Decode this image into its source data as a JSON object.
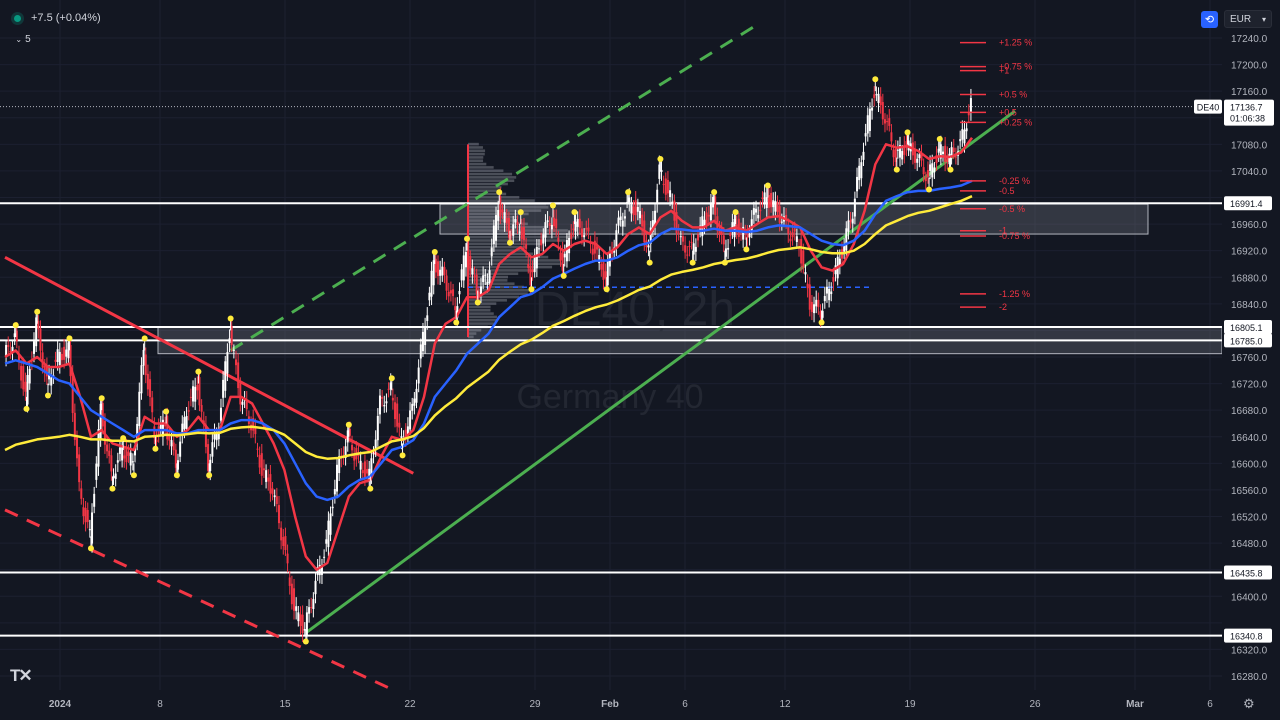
{
  "header": {
    "change": "+7.5 (+0.04%)",
    "interval": "5"
  },
  "currency": "EUR",
  "watermark": {
    "symbol": "DE40, 2h",
    "name": "Germany 40"
  },
  "chart_data": {
    "type": "candlestick",
    "symbol": "DE40",
    "timeframe": "2h",
    "y_axis": {
      "min": 16280,
      "max": 17240,
      "ticks": [
        17240.0,
        17200.0,
        17160.0,
        17120.0,
        17080.0,
        17040.0,
        17000.0,
        16960.0,
        16920.0,
        16880.0,
        16840.0,
        16800.0,
        16760.0,
        16720.0,
        16680.0,
        16640.0,
        16600.0,
        16560.0,
        16520.0,
        16480.0,
        16440.0,
        16400.0,
        16360.0,
        16320.0,
        16280.0
      ],
      "tick_labels": [
        "17240.0",
        "17200.0",
        "17160.0",
        "",
        "17080.0",
        "17040.0",
        "",
        "16960.0",
        "16920.0",
        "16880.0",
        "16840.0",
        "",
        "16760.0",
        "16720.0",
        "16680.0",
        "16640.0",
        "16600.0",
        "16560.0",
        "16520.0",
        "16480.0",
        "",
        "16400.0",
        "",
        "16320.0",
        "16280.0"
      ]
    },
    "x_axis": {
      "labels": [
        "2024",
        "8",
        "15",
        "22",
        "29",
        "Feb",
        "6",
        "12",
        "19",
        "26",
        "Mar",
        "6"
      ],
      "bold_labels": [
        "2024",
        "Feb",
        "Mar"
      ]
    },
    "price_labels": [
      {
        "text": "DE40",
        "value": 17136.7,
        "role": "symbol",
        "color": "#ffffff"
      },
      {
        "text": "17136.7",
        "value": 17136.7,
        "role": "last-price",
        "color": "#ffffff"
      },
      {
        "text": "01:06:38",
        "value": 17136.7,
        "role": "countdown",
        "color": "#ffffff"
      },
      {
        "text": "16991.4",
        "value": 16991.4,
        "role": "level",
        "color": "#ffffff"
      },
      {
        "text": "16805.1",
        "value": 16805.1,
        "role": "level",
        "color": "#ffffff"
      },
      {
        "text": "16785.0",
        "value": 16785.0,
        "role": "level",
        "color": "#ffffff"
      },
      {
        "text": "16435.8",
        "value": 16435.8,
        "role": "level",
        "color": "#ffffff"
      },
      {
        "text": "16340.8",
        "value": 16340.8,
        "role": "level",
        "color": "#ffffff"
      }
    ],
    "horizontal_levels": [
      16991.4,
      16805.1,
      16785.0,
      16435.8,
      16340.8
    ],
    "zones": [
      {
        "from": 16945,
        "to": 16990
      },
      {
        "from": 16765,
        "to": 16805
      }
    ],
    "pivot_labels": [
      {
        "text": "+1.25 %",
        "value": 17233
      },
      {
        "text": "+0.75 %",
        "value": 17197
      },
      {
        "text": "+1",
        "value": 17191
      },
      {
        "text": "+0.5 %",
        "value": 17155
      },
      {
        "text": "+0.5",
        "value": 17128
      },
      {
        "text": "+0.25 %",
        "value": 17113
      },
      {
        "text": "-0.25 %",
        "value": 17025
      },
      {
        "text": "-0.5",
        "value": 17010
      },
      {
        "text": "-0.5 %",
        "value": 16983
      },
      {
        "text": "-1",
        "value": 16950
      },
      {
        "text": "-0.75 %",
        "value": 16942
      },
      {
        "text": "-1.25 %",
        "value": 16855
      },
      {
        "text": "-2",
        "value": 16835
      }
    ],
    "price_path": [
      16760,
      16790,
      16700,
      16810,
      16720,
      16760,
      16770,
      16560,
      16490,
      16680,
      16580,
      16620,
      16600,
      16770,
      16640,
      16660,
      16600,
      16680,
      16720,
      16600,
      16660,
      16800,
      16700,
      16660,
      16590,
      16560,
      16480,
      16380,
      16350,
      16420,
      16480,
      16590,
      16640,
      16600,
      16580,
      16690,
      16710,
      16630,
      16680,
      16790,
      16900,
      16880,
      16830,
      16920,
      16860,
      16880,
      16990,
      16950,
      16960,
      16880,
      16940,
      16970,
      16900,
      16960,
      16950,
      16920,
      16880,
      16950,
      16990,
      16980,
      16920,
      17040,
      17000,
      16930,
      16920,
      16960,
      16990,
      16920,
      16960,
      16940,
      16980,
      17000,
      16980,
      16950,
      16930,
      16840,
      16830,
      16870,
      16920,
      16980,
      17080,
      17160,
      17120,
      17060,
      17080,
      17060,
      17030,
      17070,
      17060,
      17080,
      17140
    ],
    "series": [
      {
        "name": "EMA fast",
        "color": "#f23645",
        "values": [
          16760,
          16770,
          16750,
          16760,
          16745,
          16745,
          16750,
          16700,
          16640,
          16650,
          16630,
          16625,
          16620,
          16670,
          16660,
          16660,
          16640,
          16650,
          16670,
          16650,
          16650,
          16700,
          16700,
          16690,
          16660,
          16630,
          16590,
          16520,
          16460,
          16440,
          16450,
          16500,
          16550,
          16570,
          16575,
          16610,
          16640,
          16635,
          16650,
          16700,
          16780,
          16810,
          16820,
          16850,
          16850,
          16860,
          16900,
          16915,
          16925,
          16910,
          16915,
          16930,
          16920,
          16930,
          16935,
          16930,
          16915,
          16925,
          16945,
          16955,
          16945,
          16970,
          16980,
          16965,
          16955,
          16955,
          16965,
          16950,
          16955,
          16950,
          16960,
          16970,
          16972,
          16965,
          16955,
          16920,
          16895,
          16890,
          16900,
          16930,
          16980,
          17050,
          17080,
          17075,
          17077,
          17070,
          17058,
          17062,
          17061,
          17068,
          17090
        ]
      },
      {
        "name": "EMA mid",
        "color": "#2962ff",
        "values": [
          16750,
          16755,
          16750,
          16745,
          16735,
          16725,
          16720,
          16700,
          16680,
          16670,
          16660,
          16650,
          16640,
          16650,
          16650,
          16650,
          16645,
          16645,
          16650,
          16650,
          16650,
          16660,
          16665,
          16665,
          16660,
          16650,
          16630,
          16600,
          16570,
          16550,
          16545,
          16550,
          16565,
          16575,
          16580,
          16600,
          16620,
          16625,
          16635,
          16660,
          16700,
          16720,
          16740,
          16765,
          16780,
          16795,
          16820,
          16835,
          16850,
          16855,
          16865,
          16878,
          16885,
          16893,
          16900,
          16905,
          16905,
          16910,
          16920,
          16928,
          16932,
          16945,
          16953,
          16952,
          16950,
          16950,
          16953,
          16950,
          16950,
          16948,
          16950,
          16955,
          16958,
          16957,
          16955,
          16945,
          16935,
          16930,
          16928,
          16935,
          16950,
          16975,
          16995,
          17002,
          17008,
          17010,
          17010,
          17013,
          17015,
          17018,
          17025
        ]
      },
      {
        "name": "EMA slow",
        "color": "#ffeb3b",
        "values": [
          16620,
          16628,
          16632,
          16636,
          16638,
          16640,
          16643,
          16640,
          16636,
          16636,
          16634,
          16634,
          16633,
          16640,
          16641,
          16643,
          16642,
          16644,
          16646,
          16645,
          16646,
          16652,
          16654,
          16655,
          16653,
          16650,
          16643,
          16630,
          16617,
          16610,
          16607,
          16608,
          16612,
          16615,
          16617,
          16625,
          16633,
          16636,
          16641,
          16653,
          16672,
          16686,
          16698,
          16714,
          16726,
          16738,
          16756,
          16768,
          16779,
          16786,
          16796,
          16807,
          16814,
          16822,
          16829,
          16835,
          16839,
          16845,
          16853,
          16861,
          16866,
          16876,
          16884,
          16888,
          16891,
          16895,
          16900,
          16903,
          16906,
          16908,
          16912,
          16917,
          16921,
          16923,
          16925,
          16922,
          16918,
          16916,
          16916,
          16920,
          16930,
          16945,
          16958,
          16965,
          16972,
          16977,
          16980,
          16985,
          16990,
          16995,
          17002
        ]
      }
    ],
    "trendlines": [
      {
        "name": "support-up",
        "color": "#4caf50",
        "style": "solid",
        "from": {
          "i": 28,
          "v": 16345
        },
        "to": {
          "i": 94,
          "v": 17130
        }
      },
      {
        "name": "channel-up",
        "color": "#4caf50",
        "style": "dashed",
        "from": {
          "i": 21,
          "v": 16770
        },
        "to": {
          "i": 70,
          "v": 17260
        }
      },
      {
        "name": "resistance-down",
        "color": "#f23645",
        "style": "solid",
        "from": {
          "i": 0,
          "v": 16910
        },
        "to": {
          "i": 38,
          "v": 16585
        }
      },
      {
        "name": "support-down",
        "color": "#f23645",
        "style": "dashed",
        "from": {
          "i": 0,
          "v": 16530
        },
        "to": {
          "i": 36,
          "v": 16260
        }
      }
    ]
  }
}
